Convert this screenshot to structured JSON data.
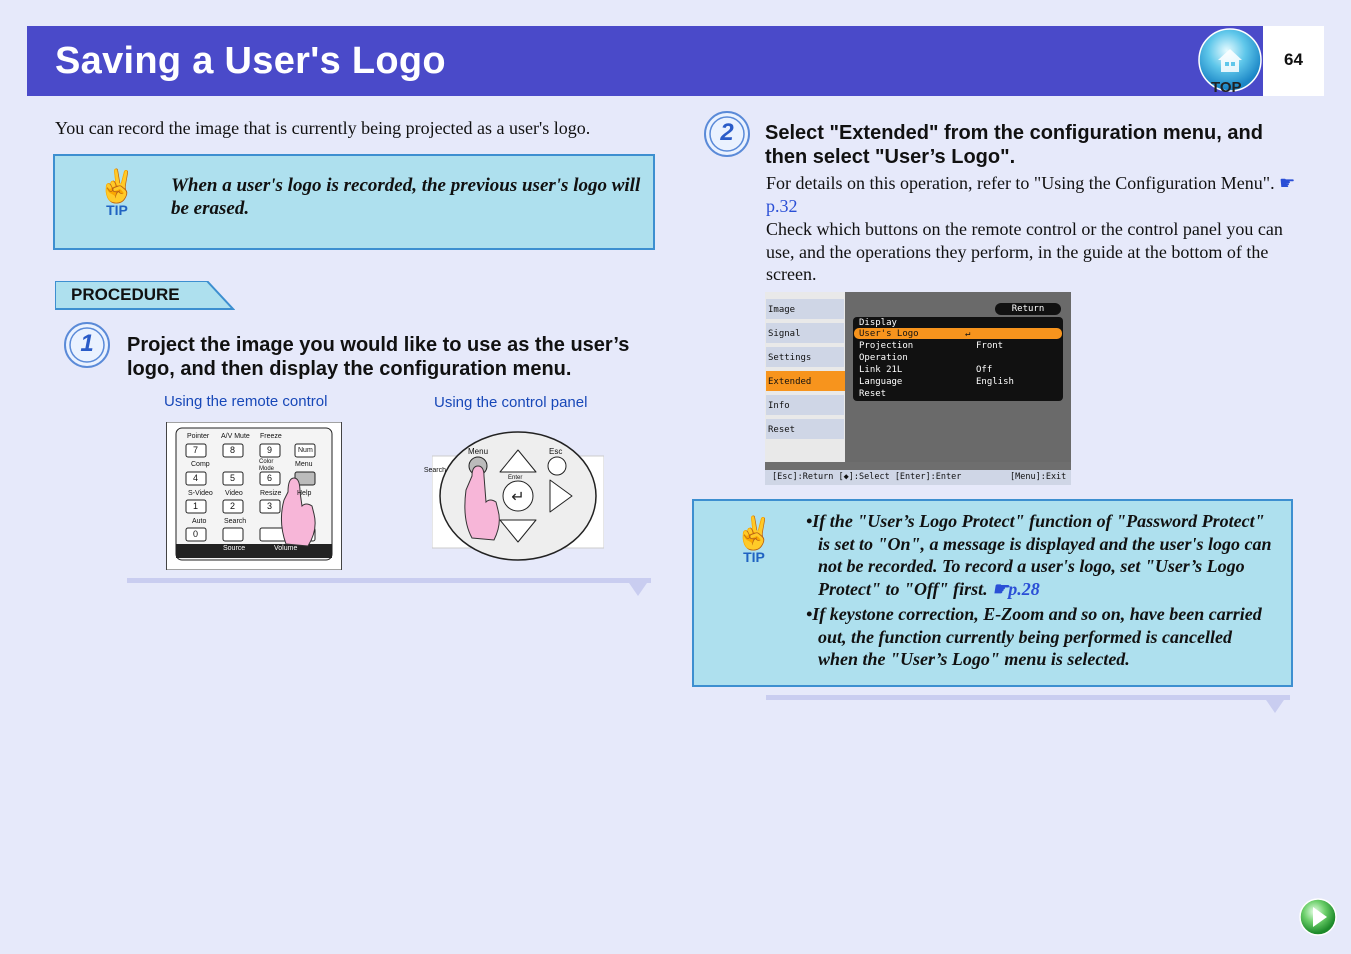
{
  "header": {
    "title": "Saving a User's Logo",
    "page_number": "64",
    "top_label": "TOP"
  },
  "intro": "You can record the image that is currently being projected as a user's logo.",
  "tip1": {
    "label": "TIP",
    "text": "When a user's logo is recorded, the previous user's logo will be erased."
  },
  "procedure_label": "PROCEDURE",
  "step1": {
    "number": "1",
    "heading": "Project the image you would like to use as the user’s logo, and then display the configuration menu.",
    "caption_remote": "Using the remote control",
    "caption_panel": "Using the control panel",
    "remote": {
      "keys_row1": [
        "Pointer",
        "A/V Mute",
        "Freeze"
      ],
      "nums_row1": [
        "7",
        "8",
        "9",
        "Num"
      ],
      "keys_row2": [
        "Comp",
        "Color Mode",
        "Menu"
      ],
      "nums_row2": [
        "4",
        "5",
        "6"
      ],
      "keys_row3": [
        "S-Video",
        "Video",
        "Resize",
        "Help"
      ],
      "nums_row3": [
        "1",
        "2",
        "3"
      ],
      "keys_row4": [
        "Auto",
        "Search"
      ],
      "nums_row4": [
        "0"
      ],
      "bottom": [
        "Source",
        "Volume"
      ]
    },
    "panel": {
      "menu": "Menu",
      "esc": "Esc",
      "enter": "Enter",
      "search": "Search"
    }
  },
  "step2": {
    "number": "2",
    "heading": "Select \"Extended\" from the configuration menu, and then select \"User’s Logo\".",
    "para1_text": "For details on this operation, refer to \"Using the Configuration Menu\". ",
    "para1_link": "p.32",
    "para2": "Check which buttons on the remote control or the control panel you can use, and the operations they perform, in the guide at the bottom of the screen.",
    "menu": {
      "left_items": [
        "Image",
        "Signal",
        "Settings",
        "Extended",
        "Info",
        "Reset"
      ],
      "return_label": "Return",
      "rows": [
        {
          "label": "Display",
          "value": ""
        },
        {
          "label": "User's Logo",
          "value": "↵"
        },
        {
          "label": "Projection",
          "value": "Front"
        },
        {
          "label": "Operation",
          "value": ""
        },
        {
          "label": "Link 21L",
          "value": "Off"
        },
        {
          "label": "Language",
          "value": "English"
        },
        {
          "label": "Reset",
          "value": ""
        }
      ],
      "footer_left": "[Esc]:Return [◆]:Select [Enter]:Enter",
      "footer_right": "[Menu]:Exit"
    }
  },
  "tip2": {
    "label": "TIP",
    "item1_text": "•If the \"User’s Logo Protect\" function of \"Password Protect\" is set to \"On\", a message is displayed and the user's logo can not be recorded. To record a user's logo, set \"User’s Logo Protect\" to \"Off\" first. ",
    "item1_link": "p.28",
    "item2": "•If keystone correction, E-Zoom and so on, have been carried out, the function currently being performed is cancelled when the \"User’s Logo\" menu is selected."
  },
  "colors": {
    "header_bg": "#4a4ac9",
    "tip_bg": "#aee0ee",
    "tip_border": "#3d8fd0",
    "menu_highlight": "#f7941d",
    "page_bg": "#e6e9fa"
  }
}
